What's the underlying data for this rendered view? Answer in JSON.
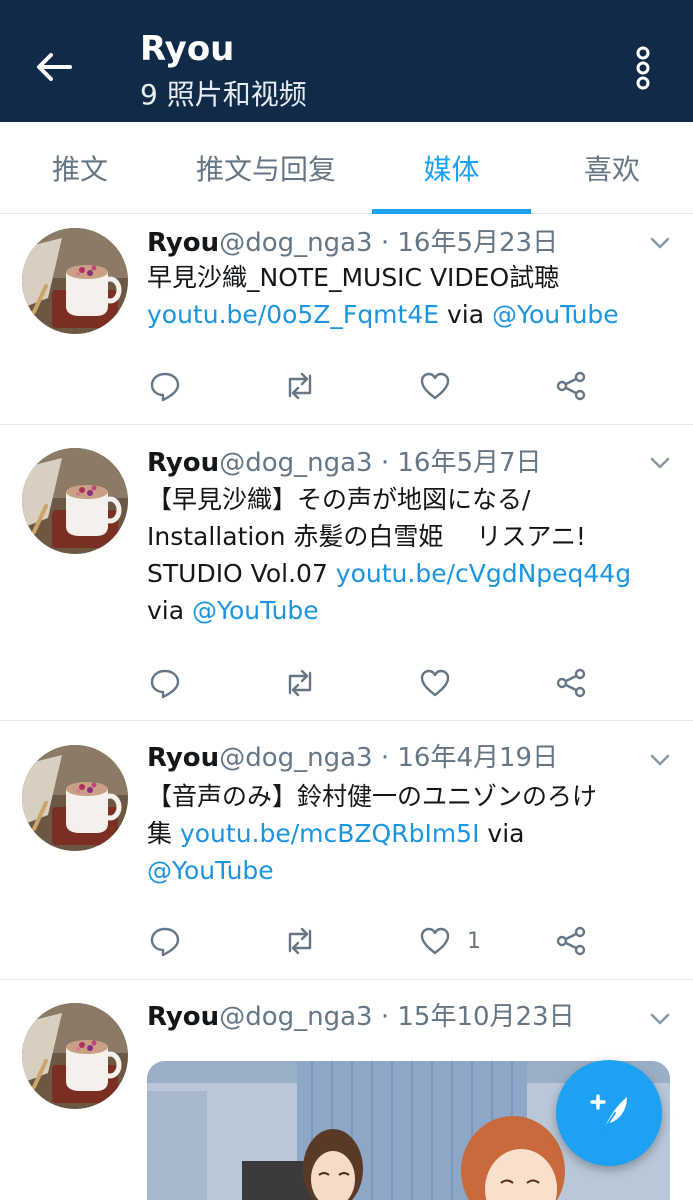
{
  "header": {
    "title": "Ryou",
    "subtitle": "9 照片和视频"
  },
  "tabs": [
    {
      "label": "推文"
    },
    {
      "label": "推文与回复"
    },
    {
      "label": "媒体"
    },
    {
      "label": "喜欢"
    }
  ],
  "active_tab": "媒体",
  "colors": {
    "header_bg": "#102a48",
    "accent": "#1da1f2",
    "link": "#1b95e0",
    "secondary_text": "#657786"
  },
  "icons": {
    "back": "arrow-left-icon",
    "more": "more-vertical-icon",
    "reply": "reply-icon",
    "retweet": "retweet-icon",
    "like": "heart-icon",
    "share": "share-icon",
    "chevron": "chevron-down-icon",
    "compose": "compose-tweet-icon"
  },
  "tweets": [
    {
      "name": "Ryou",
      "handle": "@dog_nga3",
      "sep": " · ",
      "date": "16年5月23日",
      "lines": [
        [
          {
            "text": "早見沙織_NOTE_MUSIC VIDEO試聴",
            "link": false
          }
        ],
        [
          {
            "text": "youtu.be/0o5Z_Fqmt4E",
            "link": true
          },
          {
            "text": " via ",
            "link": false
          },
          {
            "text": "@YouTube",
            "link": true
          }
        ]
      ],
      "like_count": ""
    },
    {
      "name": "Ryou",
      "handle": "@dog_nga3",
      "sep": " · ",
      "date": "16年5月7日",
      "lines": [
        [
          {
            "text": "【早見沙織】その声が地図になる/",
            "link": false
          }
        ],
        [
          {
            "text": "Installation 赤髪の白雪姫　 リスアニ!",
            "link": false
          }
        ],
        [
          {
            "text": "STUDIO Vol.07 ",
            "link": false
          },
          {
            "text": "youtu.be/cVgdNpeq44g",
            "link": true
          }
        ],
        [
          {
            "text": "via ",
            "link": false
          },
          {
            "text": "@YouTube",
            "link": true
          }
        ]
      ],
      "like_count": ""
    },
    {
      "name": "Ryou",
      "handle": "@dog_nga3",
      "sep": " · ",
      "date": "16年4月19日",
      "lines": [
        [
          {
            "text": "【音声のみ】鈴村健一のユニゾンのろけ",
            "link": false
          }
        ],
        [
          {
            "text": "集 ",
            "link": false
          },
          {
            "text": "youtu.be/mcBZQRbIm5I",
            "link": true
          },
          {
            "text": " via",
            "link": false
          }
        ],
        [
          {
            "text": "@YouTube",
            "link": true
          }
        ]
      ],
      "like_count": "1"
    },
    {
      "name": "Ryou",
      "handle": "@dog_nga3",
      "sep": " · ",
      "date": "15年10月23日",
      "lines": [],
      "like_count": ""
    }
  ]
}
